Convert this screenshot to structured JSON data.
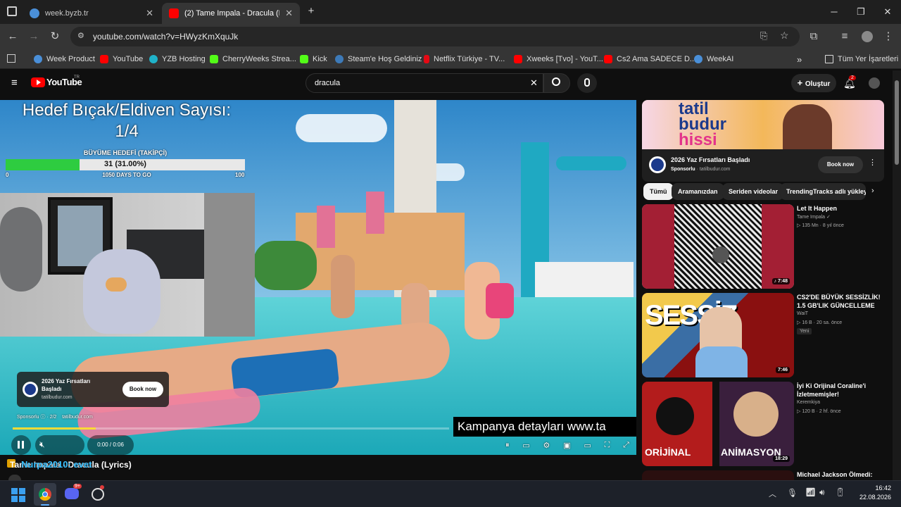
{
  "browser": {
    "tabs": [
      {
        "title": "week.byzb.tr",
        "active": false
      },
      {
        "title": "(2) Tame Impala - Dracula (Lyric",
        "active": true
      }
    ],
    "url": "youtube.com/watch?v=HWyzKmXquJk",
    "bookmarks": [
      "Week Product",
      "YouTube",
      "YZB Hosting",
      "CherryWeeks Strea...",
      "Kick",
      "Steam'e Hoş Geldiniz",
      "Netflix Türkiye - TV...",
      "Xweeks [Tvo] - YouT...",
      "Cs2 Ama SADECE D...",
      "WeekAI"
    ],
    "bookmarks_more": "»",
    "all_bookmarks": "Tüm Yer İşaretleri"
  },
  "youtube": {
    "logo_text": "YouTube",
    "logo_region": "TR",
    "search_value": "dracula",
    "create_label": "Oluştur",
    "notif_count": "2"
  },
  "overlay": {
    "goal_text_line1": "Hedef Bıçak/Eldiven Sayısı:",
    "goal_text_line2": "1/4",
    "growth_label": "BÜYÜME HEDEFİ (TAKİPÇİ)",
    "progress_text": "31 (31.00%)",
    "progress_fraction": 0.31,
    "progress_min": "0",
    "progress_max": "100",
    "days_label": "1050 DAYS TO GO"
  },
  "ad": {
    "title_line1": "2026 Yaz Fırsatları",
    "title_line2": "Başladı",
    "domain": "tatilbudur.com",
    "button": "Book now",
    "sponsored": "Sponsorlu",
    "count": "2/2",
    "domain2": "tatilbudur.com",
    "ticker": "Kampanya detayları www.ta"
  },
  "player": {
    "time": "0:00 / 0:06",
    "below_title": "Tame Impala - Dracula (Lyrics)",
    "below_overlay": "Nurpa2010: evet"
  },
  "sidebar": {
    "banner_line1": "tatil",
    "banner_line2": "budur",
    "banner_line3": "hissi",
    "ad_title": "2026 Yaz Fırsatları Başladı",
    "ad_sponsor": "Sponsorlu",
    "ad_domain": "tatilbudur.com",
    "ad_button": "Book now",
    "chips": [
      "Tümü",
      "Aramanızdan",
      "Seriden videolar",
      "TrendingTracks adlı yükley"
    ],
    "videos": [
      {
        "title": "Let It Happen",
        "channel": "Tame Impala",
        "meta": "135 Mn · 8 yıl önce",
        "duration": "7:48",
        "badge": ""
      },
      {
        "title": "CS2'DE BÜYÜK SESSİZLİK! 1.5 GB'LIK GÜNCELLEME",
        "channel": "WaiT",
        "meta": "16 B · 20 sa. önce",
        "duration": "7:46",
        "badge": "Yeni"
      },
      {
        "title": "İyi Ki Orijinal Coraline'i İzletmemişler!",
        "channel": "Keremkiya",
        "meta": "120 B · 2 hf. önce",
        "duration": "18:29",
        "badge": ""
      },
      {
        "title": "Michael Jackson Ölmedi:",
        "channel": "",
        "meta": "",
        "duration": "",
        "badge": ""
      }
    ],
    "thumb_text_2": "SESSİZ",
    "thumb_text_3a": "ORİJİNAL",
    "thumb_text_3b": "ANİMASYON"
  },
  "taskbar": {
    "time": "16:42",
    "date": "22.08.2026",
    "discord_badge": "9+"
  },
  "colors": {
    "youtube_red": "#ff0000",
    "progress_green": "#2ecc40",
    "bg": "#0f0f0f",
    "chrome_frame": "#1f1f1f",
    "chrome_toolbar": "#353535"
  }
}
